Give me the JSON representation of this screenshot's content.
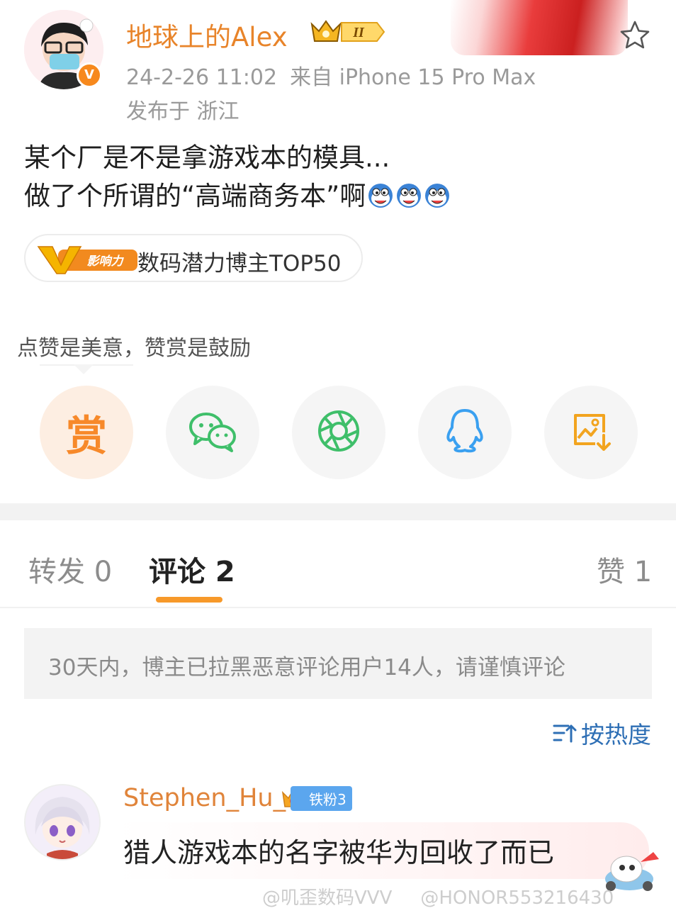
{
  "post": {
    "username": "地球上的Alex",
    "level_badge": "II",
    "date": "24-2-26 11:02",
    "source": "来自 iPhone 15 Pro Max",
    "location": "发布于 浙江",
    "text_line1": "某个厂是不是拿游戏本的模具...",
    "text_line2": "做了个所谓的“高端商务本”啊",
    "emoji_count": 3,
    "influence_tag": {
      "badge": "影响力",
      "label": "数码潜力博主TOP50"
    }
  },
  "share": {
    "tip": "点赞是美意，赞赏是鼓励",
    "reward_label": "赏",
    "buttons": [
      "reward-icon",
      "wechat-icon",
      "moments-icon",
      "qq-icon",
      "save-image-icon"
    ]
  },
  "tabs": [
    {
      "label": "转发 0",
      "active": false
    },
    {
      "label": "评论 2",
      "active": true
    },
    {
      "label": "赞 1",
      "active": false
    }
  ],
  "notice": "30天内，博主已拉黑恶意评论用户14人，请谨慎评论",
  "sort_label": "按热度",
  "comment": {
    "username": "Stephen_Hu_",
    "fan_badge": "铁粉3",
    "text": "猎人游戏本的名字被华为回收了而已"
  },
  "watermarks": [
    "@叽歪数码VVV",
    "@HONOR553216430"
  ],
  "colors": {
    "username": "#e8842a",
    "accent_orange": "#f7992a",
    "link_blue": "#2e6fb5",
    "wechat_green": "#3fbf6a",
    "qq_blue": "#3aa0f0"
  }
}
